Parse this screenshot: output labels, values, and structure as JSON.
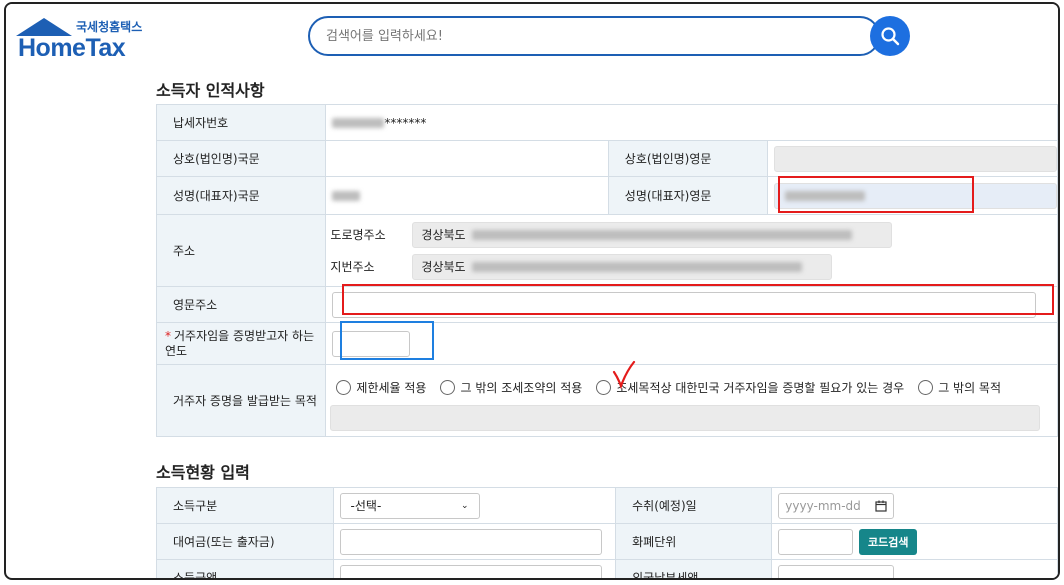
{
  "header": {
    "logo_sub": "국세청홈택스",
    "logo_main": "HomeTax",
    "search_placeholder": "검색어를 입력하세요!"
  },
  "section1": {
    "title": "소득자 인적사항",
    "taxpayer_no_label": "납세자번호",
    "taxpayer_no_suffix": "*******",
    "company_kr_label": "상호(법인명)국문",
    "company_en_label": "상호(법인명)영문",
    "name_kr_label": "성명(대표자)국문",
    "name_en_label": "성명(대표자)영문",
    "address_label": "주소",
    "road_address_label": "도로명주소",
    "road_address_value": "경상북도",
    "lot_address_label": "지번주소",
    "lot_address_value": "경상북도",
    "en_address_label": "영문주소",
    "year_label": "거주자임을 증명받고자 하는 연도",
    "required_mark": "*",
    "purpose_label": "거주자 증명을 발급받는 목적",
    "purpose_options": [
      "제한세율 적용",
      "그 밖의 조세조약의 적용",
      "조세목적상 대한민국 거주자임을 증명할 필요가 있는 경우",
      "그 밖의 목적"
    ]
  },
  "section2": {
    "title": "소득현황 입력",
    "income_type_label": "소득구분",
    "income_type_value": "-선택-",
    "receipt_date_label": "수취(예정)일",
    "date_placeholder": "yyyy-mm-dd",
    "loan_label": "대여금(또는 출자금)",
    "currency_label": "화폐단위",
    "code_search_label": "코드검색",
    "income_amount_label": "소득금액",
    "foreign_tax_label": "외국납부세액"
  },
  "colors": {
    "brand": "#1d5fb4",
    "highlight_red": "#e41b1b",
    "highlight_blue": "#1e7fe0",
    "label_bg": "#eef4f8"
  }
}
